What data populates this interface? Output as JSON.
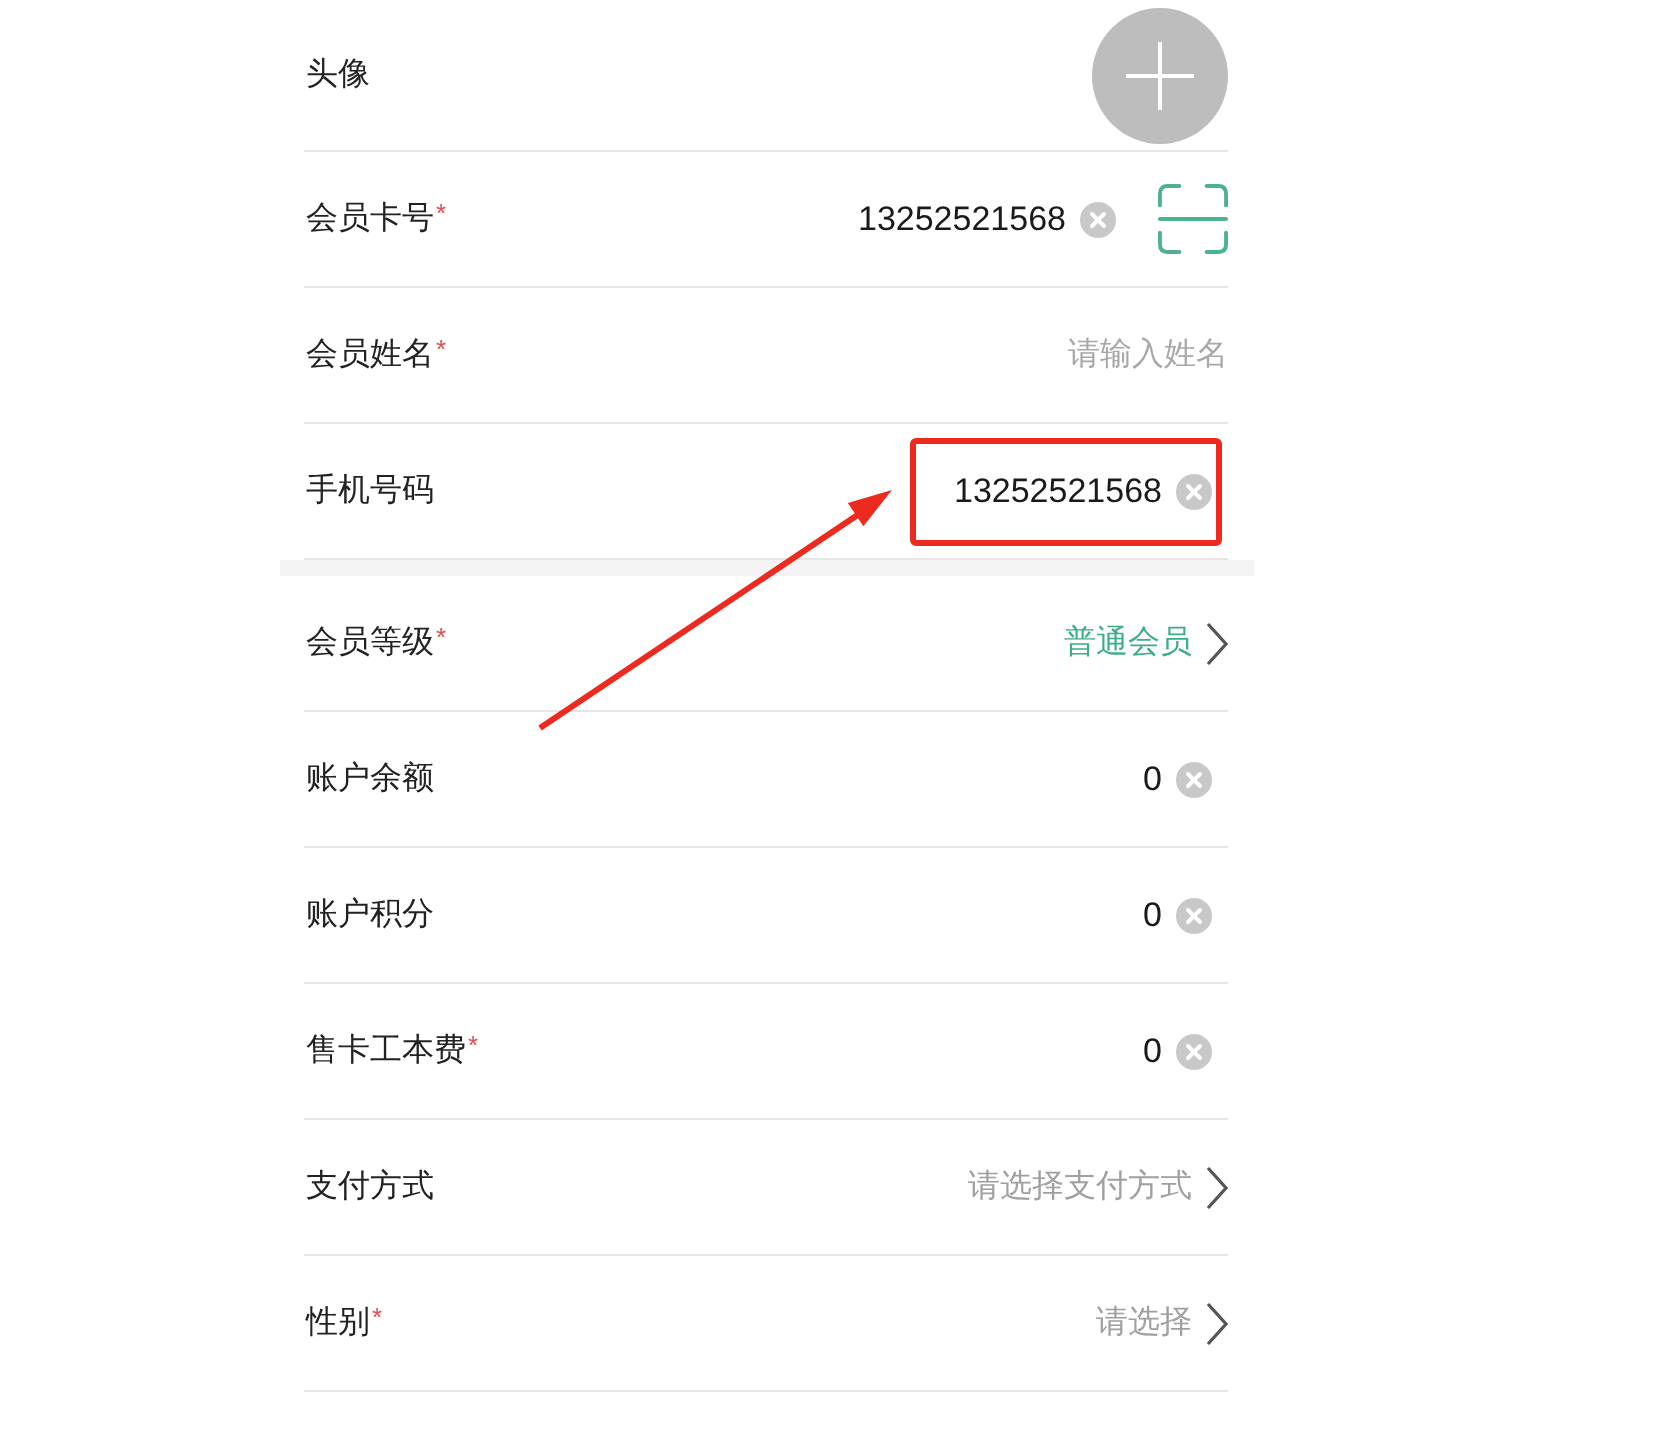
{
  "sections": [
    {
      "rows": [
        {
          "kind": "avatar",
          "label": "头像",
          "highlighted": false
        },
        {
          "kind": "text",
          "label": "会员卡号",
          "required_mark": "*",
          "value": "13252521568",
          "scan": true,
          "highlighted": false
        },
        {
          "kind": "text",
          "label": "会员姓名",
          "required_mark": "*",
          "placeholder": "请输入姓名",
          "highlighted": false
        },
        {
          "kind": "text",
          "label": "手机号码",
          "value": "13252521568",
          "highlighted": true
        }
      ]
    },
    {
      "rows": [
        {
          "kind": "select",
          "label": "会员等级",
          "required_mark": "*",
          "value": "普通会员",
          "highlighted": false
        },
        {
          "kind": "text",
          "label": "账户余额",
          "value": "0",
          "highlighted": false
        },
        {
          "kind": "text",
          "label": "账户积分",
          "value": "0",
          "highlighted": false
        },
        {
          "kind": "text",
          "label": "售卡工本费",
          "required_mark": "*",
          "value": "0",
          "highlighted": false
        },
        {
          "kind": "select",
          "label": "支付方式",
          "placeholder": "请选择支付方式",
          "highlighted": false
        },
        {
          "kind": "select",
          "label": "性别",
          "required_mark": "*",
          "placeholder": "请选择",
          "highlighted": false
        }
      ]
    }
  ]
}
